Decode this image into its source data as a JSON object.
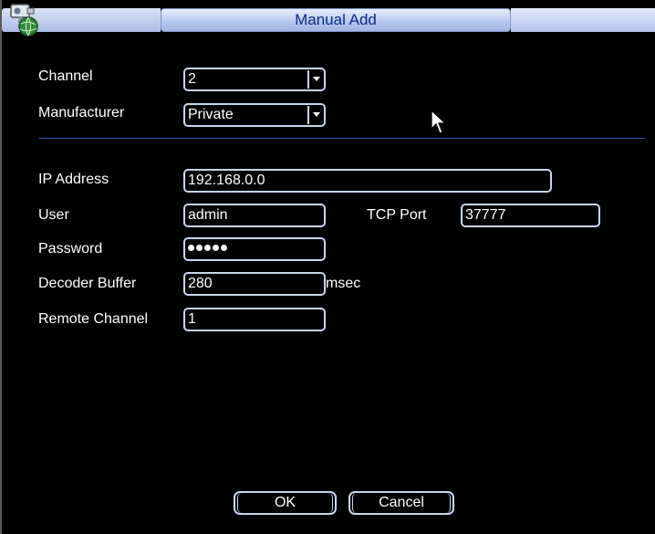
{
  "dialog": {
    "title": "Manual Add",
    "icon": "camera-globe-icon"
  },
  "form": {
    "channel": {
      "label": "Channel",
      "value": "2"
    },
    "manufacturer": {
      "label": "Manufacturer",
      "value": "Private"
    },
    "ip_address": {
      "label": "IP Address",
      "value": "192.168.0.0"
    },
    "user": {
      "label": "User",
      "value": "admin"
    },
    "tcp_port": {
      "label": "TCP Port",
      "value": "37777"
    },
    "password": {
      "label": "Password",
      "mask_length": 5
    },
    "decoder_buffer": {
      "label": "Decoder Buffer",
      "value": "280",
      "unit": "msec"
    },
    "remote_channel": {
      "label": "Remote Channel",
      "value": "1"
    }
  },
  "buttons": {
    "ok": "OK",
    "cancel": "Cancel"
  },
  "colors": {
    "background": "#000000",
    "title_text": "#0e2a87",
    "field_border": "#c9d6ec",
    "divider": "#2f5aa8"
  }
}
